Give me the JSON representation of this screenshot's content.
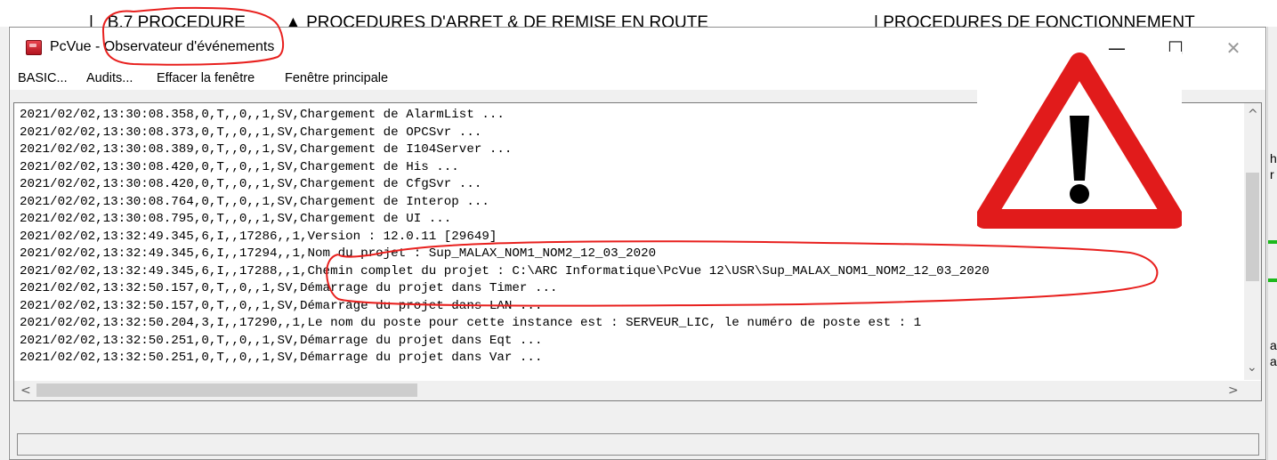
{
  "window": {
    "title_app": "PcVue - ",
    "title_name": "Observateur d'événements",
    "minimize_glyph": "—",
    "maximize_glyph": "☐",
    "close_glyph": "✕"
  },
  "menu": {
    "items": [
      "BASIC...",
      "Audits...",
      "Effacer la fenêtre",
      "Fenêtre principale"
    ]
  },
  "log": {
    "lines": [
      "2021/02/02,13:30:08.358,0,T,,0,,1,SV,Chargement de AlarmList ...",
      "2021/02/02,13:30:08.373,0,T,,0,,1,SV,Chargement de OPCSvr ...",
      "2021/02/02,13:30:08.389,0,T,,0,,1,SV,Chargement de I104Server ...",
      "2021/02/02,13:30:08.420,0,T,,0,,1,SV,Chargement de His ...",
      "2021/02/02,13:30:08.420,0,T,,0,,1,SV,Chargement de CfgSvr ...",
      "2021/02/02,13:30:08.764,0,T,,0,,1,SV,Chargement de Interop ...",
      "2021/02/02,13:30:08.795,0,T,,0,,1,SV,Chargement de UI ...",
      "2021/02/02,13:32:49.345,6,I,,17286,,1,Version : 12.0.11 [29649]",
      "2021/02/02,13:32:49.345,6,I,,17294,,1,Nom du projet : Sup_MALAX_NOM1_NOM2_12_03_2020",
      "2021/02/02,13:32:49.345,6,I,,17288,,1,Chemin complet du projet : C:\\ARC Informatique\\PcVue 12\\USR\\Sup_MALAX_NOM1_NOM2_12_03_2020",
      "2021/02/02,13:32:50.157,0,T,,0,,1,SV,Démarrage du projet dans Timer ...",
      "2021/02/02,13:32:50.157,0,T,,0,,1,SV,Démarrage du projet dans LAN ...",
      "2021/02/02,13:32:50.204,3,I,,17290,,1,Le nom du poste pour cette instance est : SERVEUR_LIC, le numéro de poste est : 1",
      "2021/02/02,13:32:50.251,0,T,,0,,1,SV,Démarrage du projet dans Eqt ...",
      "2021/02/02,13:32:50.251,0,T,,0,,1,SV,Démarrage du projet dans Var ..."
    ]
  },
  "status": {
    "text": ""
  },
  "colors": {
    "annotation": "#e8201e",
    "warning_border": "#e11b1b",
    "scroll_thumb": "#cdcdcd"
  },
  "icons": [
    "pcvue-app-icon",
    "warning-icon",
    "scroll-up-icon",
    "scroll-down-icon",
    "scroll-left-icon",
    "scroll-right-icon"
  ]
}
